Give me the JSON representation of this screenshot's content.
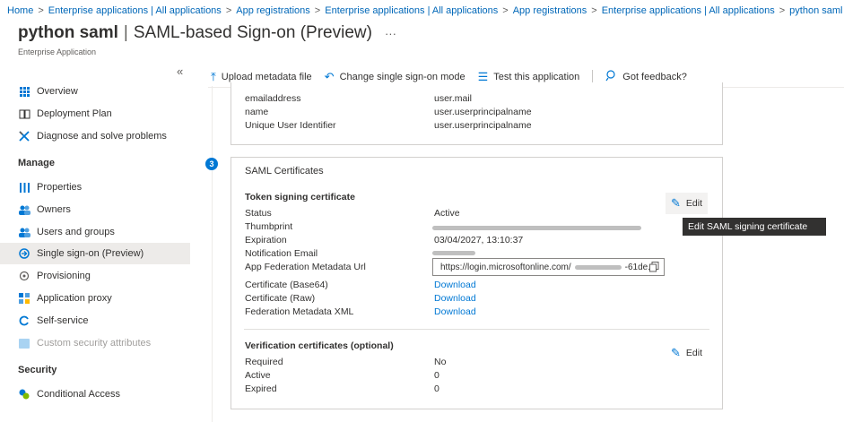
{
  "breadcrumb": {
    "items": [
      "Home",
      "Enterprise applications | All applications",
      "App registrations",
      "Enterprise applications | All applications",
      "App registrations",
      "Enterprise applications | All applications",
      "python saml"
    ],
    "separator": ">"
  },
  "page": {
    "title_bold": "python saml",
    "title_rest": "SAML-based Sign-on (Preview)",
    "pipe": "|",
    "more": "···",
    "subtitle": "Enterprise Application"
  },
  "sidebar": {
    "collapse": "«",
    "items": [
      {
        "label": "Overview",
        "icon": "overview-icon"
      },
      {
        "label": "Deployment Plan",
        "icon": "book-icon"
      },
      {
        "label": "Diagnose and solve problems",
        "icon": "tools-icon"
      },
      {
        "label": "Properties",
        "icon": "properties-icon"
      },
      {
        "label": "Owners",
        "icon": "users-icon"
      },
      {
        "label": "Users and groups",
        "icon": "users-icon"
      },
      {
        "label": "Single sign-on (Preview)",
        "icon": "sso-icon"
      },
      {
        "label": "Provisioning",
        "icon": "provisioning-icon"
      },
      {
        "label": "Application proxy",
        "icon": "proxy-icon"
      },
      {
        "label": "Self-service",
        "icon": "self-service-icon"
      },
      {
        "label": "Custom security attributes",
        "icon": "attributes-icon"
      },
      {
        "label": "Conditional Access",
        "icon": "conditional-access-icon"
      }
    ],
    "headers": {
      "manage": "Manage",
      "security": "Security"
    }
  },
  "toolbar": {
    "upload": "Upload metadata file",
    "change": "Change single sign-on mode",
    "test": "Test this application",
    "feedback": "Got feedback?"
  },
  "claims": {
    "rows": [
      {
        "label": "emailaddress",
        "value": "user.mail"
      },
      {
        "label": "name",
        "value": "user.userprincipalname"
      },
      {
        "label": "Unique User Identifier",
        "value": "user.userprincipalname"
      }
    ]
  },
  "saml_cert": {
    "step": "3",
    "title": "SAML Certificates",
    "token_heading": "Token signing certificate",
    "status_label": "Status",
    "status_value": "Active",
    "thumbprint_label": "Thumbprint",
    "expiration_label": "Expiration",
    "expiration_value": "03/04/2027, 13:10:37",
    "notification_label": "Notification Email",
    "metadata_url_label": "App Federation Metadata Url",
    "metadata_url_value": "https://login.microsoftonline.com/",
    "metadata_url_tail": "-61de...",
    "cert_base64_label": "Certificate (Base64)",
    "cert_raw_label": "Certificate (Raw)",
    "fed_xml_label": "Federation Metadata XML",
    "download": "Download",
    "edit": "Edit",
    "tooltip": "Edit SAML signing certificate",
    "verification_heading": "Verification certificates (optional)",
    "required_label": "Required",
    "required_value": "No",
    "active_label": "Active",
    "active_value": "0",
    "expired_label": "Expired",
    "expired_value": "0"
  },
  "colors": {
    "accent": "#0078d4",
    "link": "#0067b8",
    "selected_bg": "#edebe9",
    "tooltip_bg": "#323130"
  }
}
